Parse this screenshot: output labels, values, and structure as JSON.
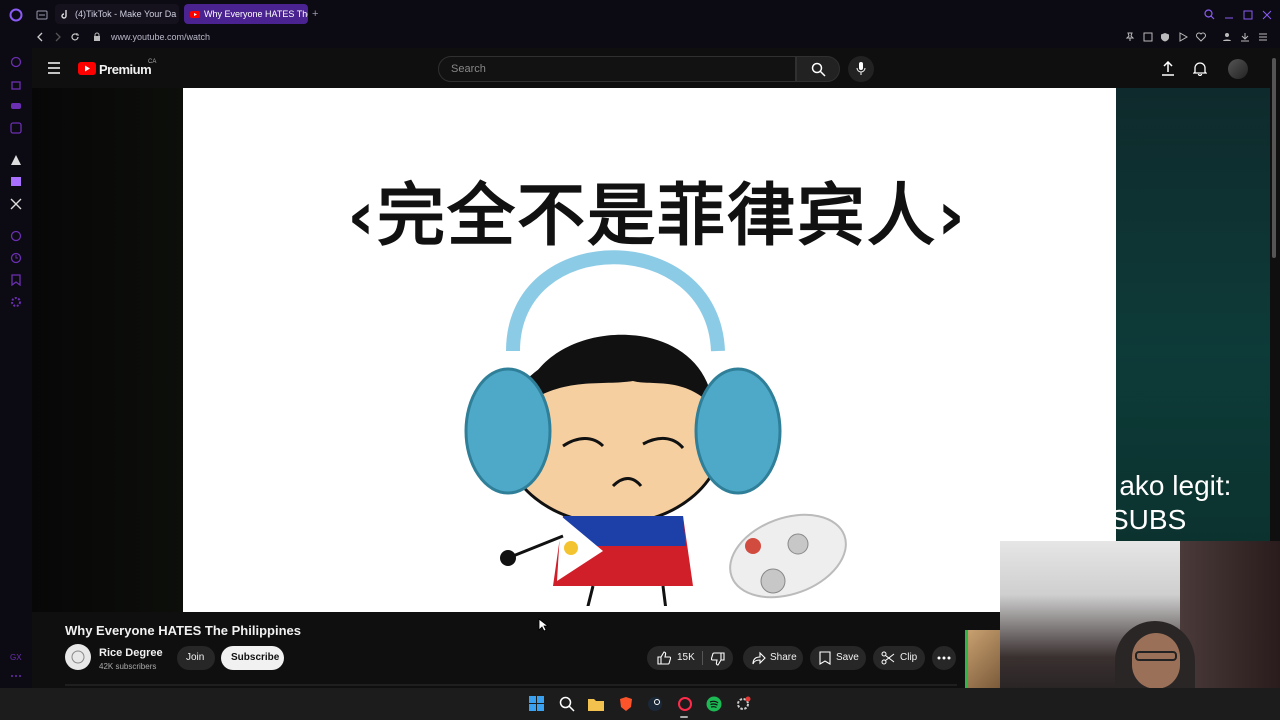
{
  "browser": {
    "tabs": [
      {
        "label": "(4)TikTok - Make Your Da",
        "active": false
      },
      {
        "label": "Why Everyone HATES The",
        "active": true
      }
    ],
    "new_tab_label": "+",
    "url": "www.youtube.com/watch"
  },
  "youtube": {
    "logo_text": "Premium",
    "region": "CA",
    "search_placeholder": "Search"
  },
  "video": {
    "caption_text": "‹完全不是菲律宾人›",
    "overlay_line1": "oit ako legit:",
    "overlay_line2": "SUBS",
    "title": "Why Everyone HATES The Philippines",
    "channel_name": "Rice Degree",
    "subscribers": "42K subscribers",
    "join_label": "Join",
    "subscribe_label": "Subscribe",
    "likes": "15K",
    "share_label": "Share",
    "save_label": "Save",
    "clip_label": "Clip"
  },
  "colors": {
    "accent_purple": "#6b2fb3",
    "youtube_red": "#ff0000",
    "ambient_teal": "#0d3b38"
  }
}
